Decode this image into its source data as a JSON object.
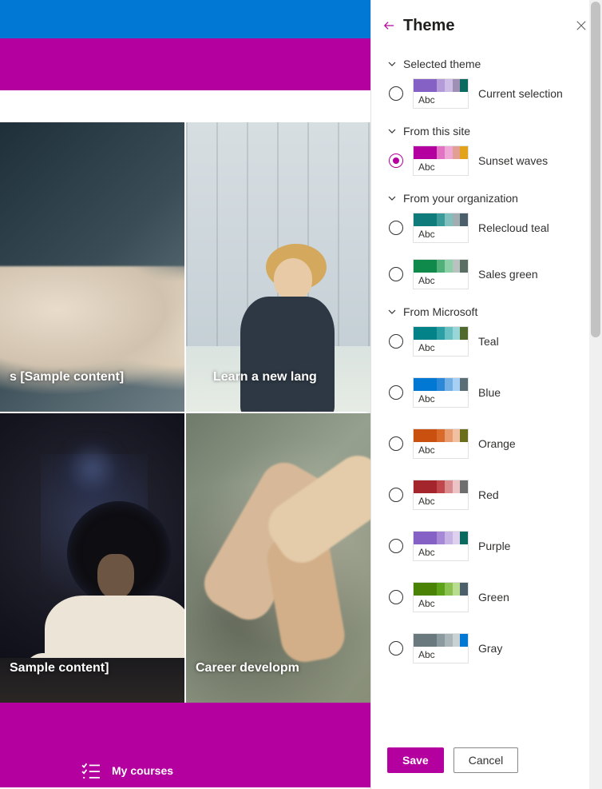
{
  "main": {
    "tiles": {
      "t1": "s [Sample content]",
      "t2": "Learn a new lang",
      "t3": "Sample content]",
      "t4": "Career developm"
    },
    "bottom": {
      "my_courses": "My courses"
    }
  },
  "panel": {
    "title": "Theme",
    "swatch_text": "Abc",
    "sections": {
      "selected": {
        "header": "Selected theme",
        "items": {
          "current": {
            "label": "Current selection",
            "colors": [
              "#8661c5",
              "#b59ad8",
              "#cdbce5",
              "#9e8fb5",
              "#0b6a5f"
            ],
            "selected": false
          }
        }
      },
      "site": {
        "header": "From this site",
        "items": {
          "sunset": {
            "label": "Sunset waves",
            "colors": [
              "#b4009e",
              "#e272c3",
              "#efa8d6",
              "#e29f92",
              "#e2a31a"
            ],
            "selected": true
          }
        }
      },
      "org": {
        "header": "From your organization",
        "items": {
          "relecloud": {
            "label": "Relecloud teal",
            "colors": [
              "#0f7c7b",
              "#3a9b9a",
              "#7fc0bf",
              "#a1aeb1",
              "#4a5f6a"
            ],
            "selected": false
          },
          "salesgreen": {
            "label": "Sales green",
            "colors": [
              "#0f8a4a",
              "#4fb07a",
              "#8cd0a9",
              "#b8c2be",
              "#5a6e64"
            ],
            "selected": false
          }
        }
      },
      "ms": {
        "header": "From Microsoft",
        "items": {
          "teal": {
            "label": "Teal",
            "colors": [
              "#038387",
              "#2aa0a4",
              "#68c0c3",
              "#98d6d8",
              "#4f6a2c"
            ],
            "selected": false
          },
          "blue": {
            "label": "Blue",
            "colors": [
              "#0078d4",
              "#2b88d8",
              "#71afe5",
              "#a6d1f5",
              "#5a6e78"
            ],
            "selected": false
          },
          "orange": {
            "label": "Orange",
            "colors": [
              "#ca5010",
              "#da6a2a",
              "#e89b6e",
              "#f0c0a0",
              "#6a6e1a"
            ],
            "selected": false
          },
          "red": {
            "label": "Red",
            "colors": [
              "#a4262c",
              "#c0474c",
              "#d98b8e",
              "#ecc4c6",
              "#6e6e6e"
            ],
            "selected": false
          },
          "purple": {
            "label": "Purple",
            "colors": [
              "#8661c5",
              "#a788d6",
              "#c7b4e5",
              "#ddd1ef",
              "#0b6a5f"
            ],
            "selected": false
          },
          "green": {
            "label": "Green",
            "colors": [
              "#498205",
              "#5ea21a",
              "#8cc350",
              "#b8dd8e",
              "#4a5f6a"
            ],
            "selected": false
          },
          "gray": {
            "label": "Gray",
            "colors": [
              "#69797e",
              "#8a9a9f",
              "#aab6ba",
              "#c9d1d3",
              "#0078d4"
            ],
            "selected": false
          }
        }
      }
    },
    "actions": {
      "save": "Save",
      "cancel": "Cancel"
    }
  }
}
